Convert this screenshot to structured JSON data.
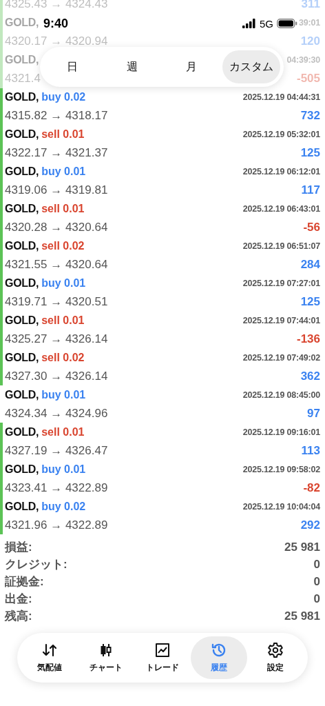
{
  "status_bar": {
    "time": "9:40",
    "network": "5G"
  },
  "period_tabs": [
    {
      "label": "日",
      "selected": false
    },
    {
      "label": "週",
      "selected": false
    },
    {
      "label": "月",
      "selected": false
    },
    {
      "label": "カスタム",
      "selected": true
    }
  ],
  "trades": [
    {
      "prices": "4325.43 → 4324.43",
      "profit": "311",
      "loss": false,
      "marked": true
    },
    {
      "symbol": "GOLD,",
      "time": "39:01",
      "prices": "4320.17 → 4320.94",
      "profit": "120",
      "loss": false,
      "marked": true
    },
    {
      "symbol": "GOLD,",
      "time": "04:39:30",
      "prices": "4321.4",
      "profit": "-505",
      "loss": true,
      "marked": true
    },
    {
      "symbol": "GOLD,",
      "sell": false,
      "order": "buy 0.02",
      "time": "2025.12.19 04:44:31",
      "prices": "4315.82 → 4318.17",
      "profit": "732",
      "loss": false,
      "marked": true
    },
    {
      "symbol": "GOLD,",
      "sell": true,
      "order": "sell 0.01",
      "time": "2025.12.19 05:32:01",
      "prices": "4322.17 → 4321.37",
      "profit": "125",
      "loss": false,
      "marked": true
    },
    {
      "symbol": "GOLD,",
      "sell": false,
      "order": "buy 0.01",
      "time": "2025.12.19 06:12:01",
      "prices": "4319.06 → 4319.81",
      "profit": "117",
      "loss": false,
      "marked": true
    },
    {
      "symbol": "GOLD,",
      "sell": true,
      "order": "sell 0.01",
      "time": "2025.12.19 06:43:01",
      "prices": "4320.28 → 4320.64",
      "profit": "-56",
      "loss": true,
      "marked": true
    },
    {
      "symbol": "GOLD,",
      "sell": true,
      "order": "sell 0.02",
      "time": "2025.12.19 06:51:07",
      "prices": "4321.55 → 4320.64",
      "profit": "284",
      "loss": false,
      "marked": true
    },
    {
      "symbol": "GOLD,",
      "sell": false,
      "order": "buy 0.01",
      "time": "2025.12.19 07:27:01",
      "prices": "4319.71 → 4320.51",
      "profit": "125",
      "loss": false,
      "marked": true
    },
    {
      "symbol": "GOLD,",
      "sell": true,
      "order": "sell 0.01",
      "time": "2025.12.19 07:44:01",
      "prices": "4325.27 → 4326.14",
      "profit": "-136",
      "loss": true,
      "marked": true
    },
    {
      "symbol": "GOLD,",
      "sell": true,
      "order": "sell 0.02",
      "time": "2025.12.19 07:49:02",
      "prices": "4327.30 → 4326.14",
      "profit": "362",
      "loss": false,
      "marked": true
    },
    {
      "symbol": "GOLD,",
      "sell": false,
      "order": "buy 0.01",
      "time": "2025.12.19 08:45:00",
      "prices": "4324.34 → 4324.96",
      "profit": "97",
      "loss": false,
      "marked": false
    },
    {
      "symbol": "GOLD,",
      "sell": true,
      "order": "sell 0.01",
      "time": "2025.12.19 09:16:01",
      "prices": "4327.19 → 4326.47",
      "profit": "113",
      "loss": false,
      "marked": true
    },
    {
      "symbol": "GOLD,",
      "sell": false,
      "order": "buy 0.01",
      "time": "2025.12.19 09:58:02",
      "prices": "4323.41 → 4322.89",
      "profit": "-82",
      "loss": true,
      "marked": true
    },
    {
      "symbol": "GOLD,",
      "sell": false,
      "order": "buy 0.02",
      "time": "2025.12.19 10:04:04",
      "prices": "4321.96 → 4322.89",
      "profit": "292",
      "loss": false,
      "marked": true
    }
  ],
  "summary": [
    {
      "label": "損益:",
      "value": "25 981"
    },
    {
      "label": "クレジット:",
      "value": "0"
    },
    {
      "label": "証拠金:",
      "value": "0"
    },
    {
      "label": "出金:",
      "value": "0"
    },
    {
      "label": "残高:",
      "value": "25 981"
    }
  ],
  "tab_bar": [
    {
      "kind": "quotes",
      "label": "気配値",
      "selected": false
    },
    {
      "kind": "chart",
      "label": "チャート",
      "selected": false
    },
    {
      "kind": "trade",
      "label": "トレード",
      "selected": false
    },
    {
      "kind": "history",
      "label": "履歴",
      "selected": true
    },
    {
      "kind": "settings",
      "label": "設定",
      "selected": false
    }
  ]
}
